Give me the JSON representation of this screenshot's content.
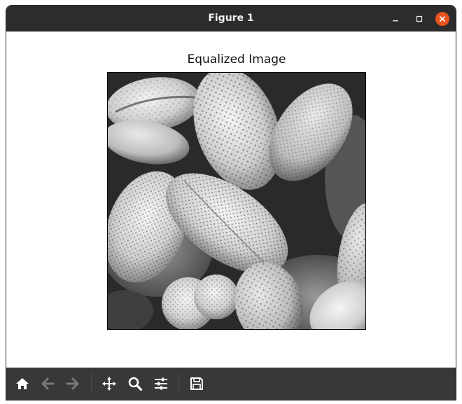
{
  "window": {
    "title": "Figure 1"
  },
  "figure": {
    "title": "Equalized Image",
    "image_description_icon": "grayscale-pollen-image"
  },
  "toolbar": {
    "items": [
      {
        "icon": "home-icon",
        "enabled": true
      },
      {
        "icon": "back-arrow-icon",
        "enabled": false
      },
      {
        "icon": "forward-arrow-icon",
        "enabled": false
      },
      {
        "icon": "pan-move-icon",
        "enabled": true
      },
      {
        "icon": "zoom-icon",
        "enabled": true
      },
      {
        "icon": "configure-subplots-icon",
        "enabled": true
      },
      {
        "icon": "save-icon",
        "enabled": true
      }
    ]
  },
  "colors": {
    "titlebar": "#2c2c2c",
    "toolbar": "#383838",
    "close_button": "#e9541e",
    "icon_enabled": "#ffffff",
    "icon_disabled": "#7a7a7a"
  }
}
